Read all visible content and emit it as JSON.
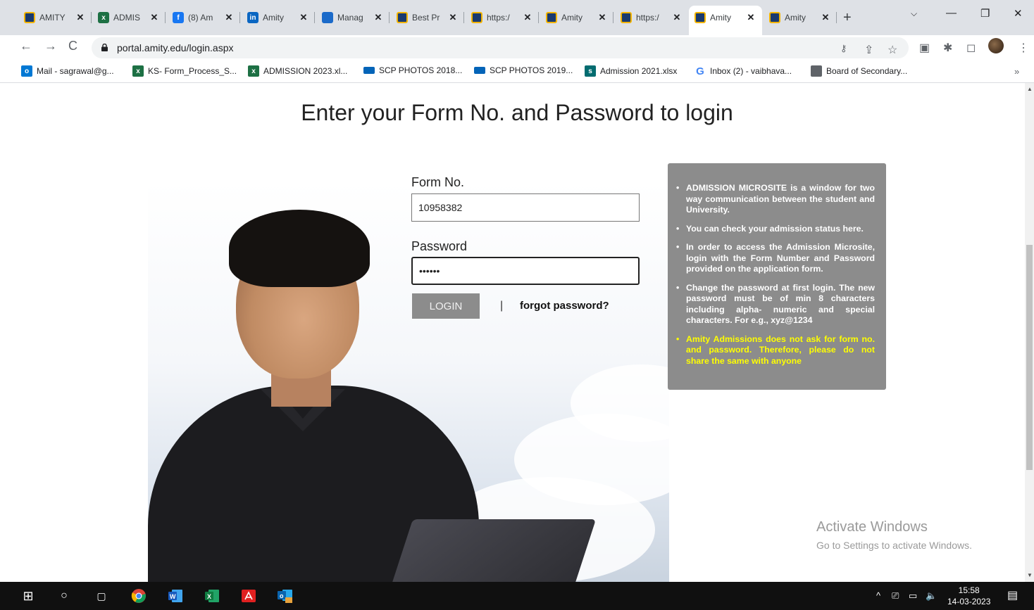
{
  "browser": {
    "tabs": [
      {
        "title": "AMITY",
        "icon": "amity-shield-icon"
      },
      {
        "title": "ADMIS",
        "icon": "excel-icon"
      },
      {
        "title": "(8) Am",
        "icon": "facebook-icon"
      },
      {
        "title": "Amity",
        "icon": "linkedin-icon"
      },
      {
        "title": "Manag",
        "icon": "manage-icon"
      },
      {
        "title": "Best Pr",
        "icon": "amity-shield-icon"
      },
      {
        "title": "https:/",
        "icon": "amity-shield-icon"
      },
      {
        "title": "Amity",
        "icon": "amity-shield-icon"
      },
      {
        "title": "https:/",
        "icon": "amity-shield-icon"
      },
      {
        "title": "Amity",
        "icon": "amity-shield-icon",
        "active": true
      },
      {
        "title": "Amity",
        "icon": "amity-shield-icon"
      }
    ],
    "url": "portal.amity.edu/login.aspx",
    "bookmarks": [
      {
        "label": "Mail - sagrawal@g...",
        "icon": "outlook-icon"
      },
      {
        "label": "KS- Form_Process_S...",
        "icon": "excel-icon"
      },
      {
        "label": "ADMISSION 2023.xl...",
        "icon": "excel-icon"
      },
      {
        "label": "SCP PHOTOS 2018...",
        "icon": "onedrive-icon"
      },
      {
        "label": "SCP PHOTOS 2019...",
        "icon": "onedrive-icon"
      },
      {
        "label": "Admission 2021.xlsx",
        "icon": "sharepoint-icon"
      },
      {
        "label": "Inbox (2) - vaibhava...",
        "icon": "google-icon"
      },
      {
        "label": "Board of Secondary...",
        "icon": "globe-icon"
      }
    ]
  },
  "page": {
    "heading": "Enter your Form No. and Password to login",
    "form_no_label": "Form No.",
    "form_no_value": "10958382",
    "password_label": "Password",
    "password_value": "••••••",
    "login_label": "LOGIN",
    "separator": "|",
    "forgot_label": "forgot password?",
    "info": [
      "ADMISSION MICROSITE is a window for two way communication between the student and University.",
      "You can check your admission status here.",
      "In order to access the Admission Microsite, login with the Form Number and Password provided on the application form.",
      "Change the password at first login. The new password must be of min 8 characters including alpha- numeric and special characters. For e.g., xyz@1234",
      "Amity Admissions does not ask for form no. and password. Therefore, please do not share the same with anyone"
    ],
    "warn_color": "#ffff00",
    "info_bg": "#8c8c8c"
  },
  "watermark": {
    "line1": "Activate Windows",
    "line2": "Go to Settings to activate Windows."
  },
  "taskbar": {
    "time": "15:58",
    "date": "14-03-2023"
  }
}
